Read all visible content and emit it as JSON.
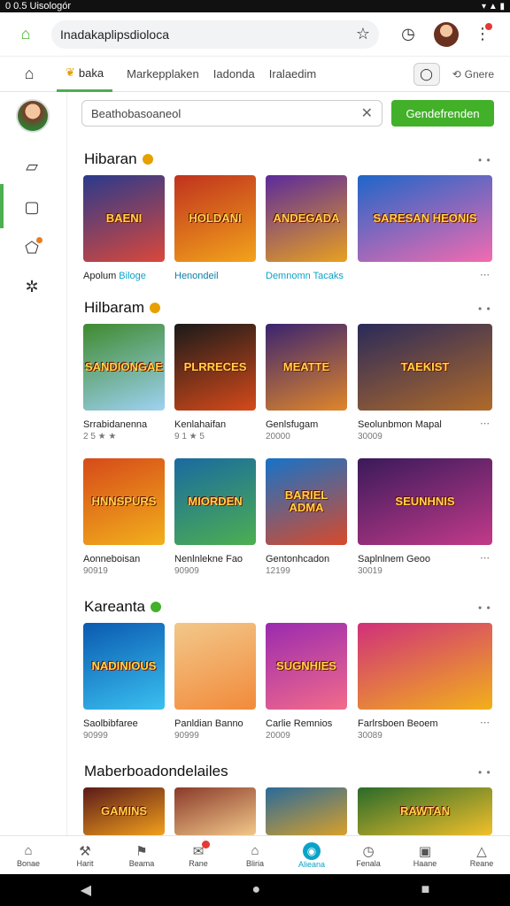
{
  "status": {
    "left": "0 0.5 Uisologór",
    "icons": "▾ ▲ ▮"
  },
  "url": {
    "text": "Inadakaplipsdioloca"
  },
  "tabs": [
    {
      "label": "baka"
    },
    {
      "label": "Markepplaken"
    },
    {
      "label": "Iadonda"
    },
    {
      "label": "Iralaedim"
    }
  ],
  "tabs_right": {
    "share_label": "Gnere"
  },
  "search": {
    "value": "Beathobasoaneol",
    "button": "Gendefrenden"
  },
  "sections": [
    {
      "title": "Hibaran",
      "items": [
        {
          "art": "BAENI",
          "title": "Apolum",
          "sub": "Biloge",
          "colors": [
            "#2a3a8c",
            "#d9483b"
          ]
        },
        {
          "art": "HOLDANI",
          "title": "Henondeil",
          "sub": "",
          "colors": [
            "#c0321e",
            "#f2a31b"
          ]
        },
        {
          "art": "ANDEGADA",
          "title": "Demnomn Tacaks",
          "sub": "",
          "colors": [
            "#5b2a9c",
            "#e8a020"
          ]
        },
        {
          "art": "SARESAN HEONIS",
          "title": "",
          "sub": "",
          "colors": [
            "#1e66c9",
            "#f26bb0"
          ]
        }
      ]
    },
    {
      "title": "Hilbaram",
      "items": [
        {
          "art": "SANDIONGAE",
          "title": "Srrabidanenna",
          "sub": "2 5 ★ ★",
          "colors": [
            "#3e8a2e",
            "#9fd2f3"
          ]
        },
        {
          "art": "PLRRECES",
          "title": "Kenlahaifan",
          "sub": "9 1 ★ 5",
          "colors": [
            "#1a1a1a",
            "#d64a1a"
          ]
        },
        {
          "art": "MEATTE",
          "title": "Genlsfugam",
          "sub": "20000",
          "colors": [
            "#3a2470",
            "#e0862a"
          ]
        },
        {
          "art": "TAEKIST",
          "title": "Seolunbmon Mapal",
          "sub": "30009",
          "colors": [
            "#2a2a5a",
            "#b06a2a"
          ]
        }
      ]
    },
    {
      "title": "",
      "items": [
        {
          "art": "HNNSPURS",
          "title": "Aonneboisan",
          "sub": "90919",
          "colors": [
            "#d64a1a",
            "#f2b01b"
          ]
        },
        {
          "art": "MIORDEN",
          "title": "Nenlnlekne Fao",
          "sub": "90909",
          "colors": [
            "#1a6aa0",
            "#4caf50"
          ]
        },
        {
          "art": "BARIEL ADMA",
          "title": "Gentonhcadon",
          "sub": "12199",
          "colors": [
            "#1673c9",
            "#d84a2a"
          ]
        },
        {
          "art": "SEUNHNIS",
          "title": "Saplnlnem Geoo",
          "sub": "30019",
          "colors": [
            "#3a1a5a",
            "#c23a8a"
          ]
        }
      ]
    },
    {
      "title": "Kareanta",
      "items": [
        {
          "art": "NADINIOUS",
          "title": "Saolbibfaree",
          "sub": "90999",
          "colors": [
            "#0a5ab0",
            "#3ac0f0"
          ]
        },
        {
          "art": "",
          "title": "Panldian Banno",
          "sub": "90999",
          "colors": [
            "#f2c88a",
            "#f28a3a"
          ]
        },
        {
          "art": "SUGNHIES",
          "title": "Carlie Remnios",
          "sub": "20009",
          "colors": [
            "#9a2ab0",
            "#f26b8a"
          ]
        },
        {
          "art": "",
          "title": "Farlrsboen Beoem",
          "sub": "30089",
          "colors": [
            "#d0307a",
            "#f2b01b"
          ]
        }
      ]
    },
    {
      "title": "Maberboadondelailes",
      "items": [
        {
          "art": "GAMINS",
          "title": "",
          "sub": "",
          "colors": [
            "#5a1a1a",
            "#f2a01b"
          ]
        },
        {
          "art": "",
          "title": "",
          "sub": "",
          "colors": [
            "#8a3a2a",
            "#f2c88a"
          ]
        },
        {
          "art": "",
          "title": "",
          "sub": "",
          "colors": [
            "#2a6a9a",
            "#d8a02a"
          ]
        },
        {
          "art": "RAWTAN",
          "title": "",
          "sub": "",
          "colors": [
            "#2a6a2a",
            "#f2c02a"
          ]
        }
      ]
    }
  ],
  "bottom_nav": [
    {
      "label": "Bonae",
      "icon": "⌂"
    },
    {
      "label": "Harit",
      "icon": "⚒"
    },
    {
      "label": "Beama",
      "icon": "⚑"
    },
    {
      "label": "Rane",
      "icon": "✉"
    },
    {
      "label": "Bliria",
      "icon": "⌂"
    },
    {
      "label": "Alieana",
      "icon": "◉"
    },
    {
      "label": "Fenala",
      "icon": "◷"
    },
    {
      "label": "Haane",
      "icon": "▣"
    },
    {
      "label": "Reane",
      "icon": "△"
    }
  ],
  "sysnav": {
    "back": "◀",
    "home": "●",
    "recents": "■"
  },
  "accent": "#43b02a"
}
